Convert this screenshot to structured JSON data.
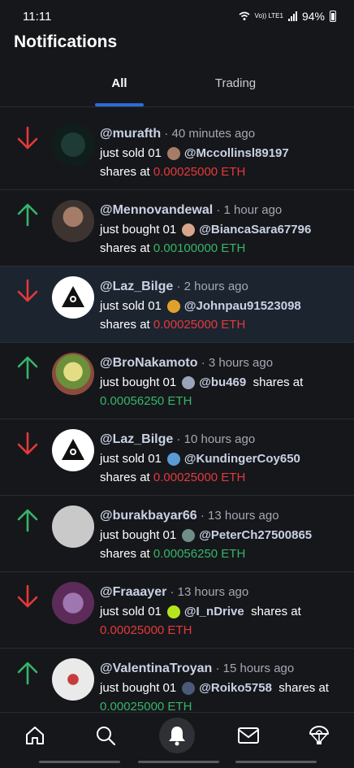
{
  "status_bar": {
    "time": "11:11",
    "network": "Vo)) LTE1",
    "battery": "94%"
  },
  "header": {
    "title": "Notifications"
  },
  "tabs": [
    {
      "label": "All",
      "active": true
    },
    {
      "label": "Trading",
      "active": false
    }
  ],
  "notifications": [
    {
      "direction": "down",
      "handle": "@murafth",
      "time": "· 40 minutes ago",
      "action": "just sold 01",
      "target": "@Mccollinsl89197",
      "shares_at": "shares at",
      "price": "0.00025000 ETH"
    },
    {
      "direction": "up",
      "handle": "@Mennovandewal",
      "time": "· 1 hour ago",
      "action": "just bought 01",
      "target": "@BiancaSara67796",
      "shares_at": "shares at",
      "price": "0.00100000 ETH"
    },
    {
      "direction": "down",
      "handle": "@Laz_Bilge",
      "time": "· 2 hours ago",
      "action": "just sold 01",
      "target": "@Johnpau91523098",
      "shares_at": "shares at",
      "price": "0.00025000 ETH"
    },
    {
      "direction": "up",
      "handle": "@BroNakamoto",
      "time": "· 3 hours ago",
      "action": "just bought 01",
      "target": "@bu469",
      "shares_at": "shares at",
      "price": "0.00056250 ETH"
    },
    {
      "direction": "down",
      "handle": "@Laz_Bilge",
      "time": "· 10 hours ago",
      "action": "just sold 01",
      "target": "@KundingerCoy650",
      "shares_at": "shares at",
      "price": "0.00025000 ETH"
    },
    {
      "direction": "up",
      "handle": "@burakbayar66",
      "time": "· 13 hours ago",
      "action": "just bought 01",
      "target": "@PeterCh27500865",
      "shares_at": "shares at",
      "price": "0.00056250 ETH"
    },
    {
      "direction": "down",
      "handle": "@Fraaayer",
      "time": "· 13 hours ago",
      "action": "just sold 01",
      "target": "@I_nDrive",
      "shares_at": "shares at",
      "price": "0.00025000 ETH"
    },
    {
      "direction": "up",
      "handle": "@ValentinaTroyan",
      "time": "· 15 hours ago",
      "action": "just bought 01",
      "target": "@Roiko5758",
      "shares_at": "shares at",
      "price": "0.00025000 ETH"
    }
  ],
  "bottom_nav": [
    {
      "icon": "home-icon"
    },
    {
      "icon": "search-icon"
    },
    {
      "icon": "bell-icon",
      "active": true
    },
    {
      "icon": "mail-icon"
    },
    {
      "icon": "parachute-icon"
    }
  ],
  "colors": {
    "accent": "#2e6bd7",
    "sell": "#e5393a",
    "buy": "#35b56a",
    "background": "#16171b"
  }
}
